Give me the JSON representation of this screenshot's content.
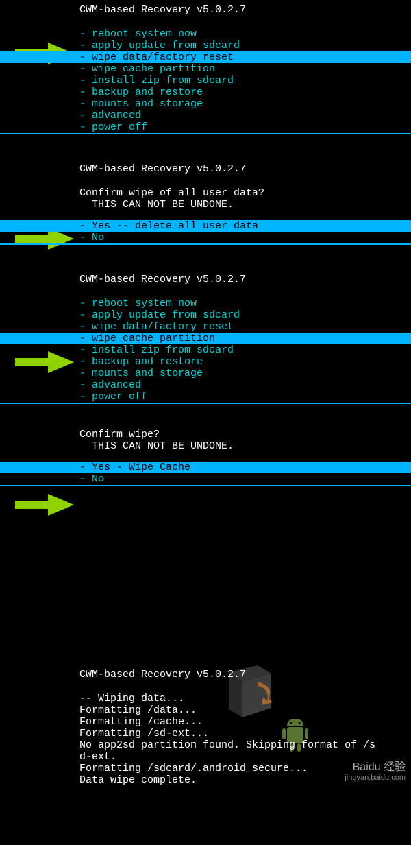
{
  "screen1": {
    "title": "CWM-based Recovery v5.0.2.7",
    "items": [
      "- reboot system now",
      "- apply update from sdcard",
      "- wipe data/factory reset",
      "- wipe cache partition",
      "- install zip from sdcard",
      "- backup and restore",
      "- mounts and storage",
      "- advanced",
      "- power off"
    ],
    "selected_index": 2
  },
  "screen2": {
    "title": "CWM-based Recovery v5.0.2.7",
    "confirm_line1": "Confirm wipe of all user data?",
    "confirm_line2": "  THIS CAN NOT BE UNDONE.",
    "items": [
      "-  Yes -- delete all user data",
      "-  No"
    ],
    "selected_index": 0
  },
  "screen3": {
    "title": "CWM-based Recovery v5.0.2.7",
    "items": [
      "- reboot system now",
      "- apply update from sdcard",
      "- wipe data/factory reset",
      "- wipe cache partition",
      "- install zip from sdcard",
      "- backup and restore",
      "- mounts and storage",
      "- advanced",
      "- power off"
    ],
    "selected_index": 3
  },
  "screen4": {
    "confirm_line1": "Confirm wipe?",
    "confirm_line2": "  THIS CAN NOT BE UNDONE.",
    "items": [
      "- Yes - Wipe Cache",
      "- No"
    ],
    "selected_index": 0
  },
  "screen5": {
    "title": "CWM-based Recovery v5.0.2.7",
    "log": [
      "-- Wiping data...",
      "Formatting /data...",
      "Formatting /cache...",
      "Formatting /sd-ext...",
      "No app2sd partition found. Skipping format of /s",
      "d-ext.",
      "Formatting /sdcard/.android_secure...",
      "Data wipe complete."
    ]
  },
  "watermark": {
    "brand": "Baidu 经验",
    "url": "jingyan.baidu.com"
  },
  "arrow_color": "#8fd400"
}
